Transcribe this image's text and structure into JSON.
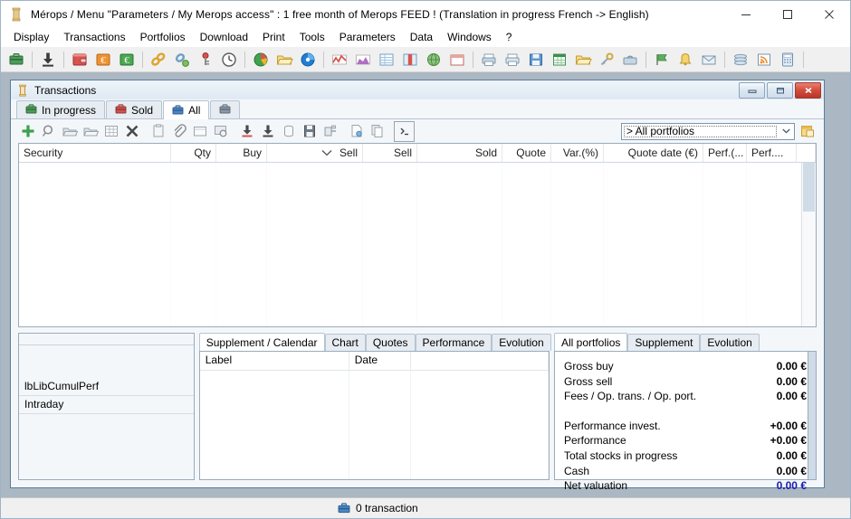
{
  "window": {
    "title": "Mérops / Menu \"Parameters / My Merops access\" : 1 free month of Merops FEED ! (Translation in progress French -> English)",
    "app_icon": "merops-column-icon",
    "controls": {
      "minimize": "minimize-icon",
      "maximize": "maximize-icon",
      "close": "close-icon"
    }
  },
  "menubar": {
    "items": [
      {
        "label": "Display"
      },
      {
        "label": "Transactions"
      },
      {
        "label": "Portfolios"
      },
      {
        "label": "Download"
      },
      {
        "label": "Print"
      },
      {
        "label": "Tools"
      },
      {
        "label": "Parameters"
      },
      {
        "label": "Data"
      },
      {
        "label": "Windows"
      },
      {
        "label": "?"
      }
    ]
  },
  "toolbar": {
    "groups": [
      [
        "briefcase-green-icon"
      ],
      [
        "download-arrow-icon"
      ],
      [
        "wallet-red-icon",
        "euro-orange-icon",
        "euro-green-icon"
      ],
      [
        "link-chain-icon",
        "link-settings-icon",
        "key-red-icon",
        "clock-icon"
      ],
      [
        "pie-chart-icon",
        "folder-yellow-icon",
        "blue-circle-icon"
      ],
      [
        "chart-line-red-icon",
        "chart-area-purple-icon",
        "table-blue-icon",
        "book-red-icon",
        "globe-green-icon",
        "window-red-icon"
      ],
      [
        "print-icon",
        "printer-icon",
        "save-blue-icon",
        "spreadsheet-green-icon",
        "folder-open-icon",
        "key-tools-icon",
        "toolbox-icon"
      ],
      [
        "flag-green-icon",
        "bell-yellow-icon",
        "mail-icon"
      ],
      [
        "layers-icon",
        "rss-orange-icon",
        "calculator-blue-icon"
      ]
    ]
  },
  "mdi": {
    "title": "Transactions",
    "title_icon": "merops-column-icon",
    "buttons": {
      "minimize": "mdi-minimize-icon",
      "restore": "mdi-restore-icon",
      "close": "mdi-close-icon"
    },
    "tabs": [
      {
        "label": "In progress",
        "icon": "briefcase-green-icon",
        "active": false
      },
      {
        "label": "Sold",
        "icon": "briefcase-red-icon",
        "active": false
      },
      {
        "label": "All",
        "icon": "briefcase-blue-icon",
        "active": true
      },
      {
        "label": "",
        "icon": "briefcase-grey-icon",
        "active": false
      }
    ],
    "row_toolbar": [
      "add-plus-icon",
      "search-magnifier-icon",
      "archive-in-icon",
      "archive-out-icon",
      "grid-table-icon",
      "delete-x-icon",
      "clipboard-icon",
      "attachment-clip-icon",
      "note-icon",
      "note-search-icon",
      "import-down-red-icon",
      "export-down-icon",
      "database-icon",
      "save-doc-icon",
      "printer-small-icon",
      "new-doc-icon",
      "copy-doc-icon",
      "console-icon"
    ],
    "portfolio_select": {
      "value": "> All portfolios",
      "arrow_icon": "chevron-down-icon",
      "extra_icon": "portfolio-edit-icon"
    }
  },
  "grid": {
    "columns": [
      {
        "label": "Security",
        "align": "left",
        "width": 168
      },
      {
        "label": "Qty",
        "align": "right",
        "width": 50
      },
      {
        "label": "Buy",
        "align": "right",
        "width": 56
      },
      {
        "label": "Sell",
        "align": "right",
        "width": 106,
        "sort_icon": "sort-desc-icon"
      },
      {
        "label": "Sell",
        "align": "right",
        "width": 60
      },
      {
        "label": "Sold",
        "align": "right",
        "width": 94
      },
      {
        "label": "Quote",
        "align": "right",
        "width": 54
      },
      {
        "label": "Var.(%)",
        "align": "right",
        "width": 58
      },
      {
        "label": "Quote date (€)",
        "align": "right",
        "width": 110
      },
      {
        "label": "Perf.(...",
        "align": "left",
        "width": 48
      },
      {
        "label": "Perf....",
        "align": "left",
        "width": 55
      }
    ],
    "rows": []
  },
  "left_panel": {
    "rows": [
      {
        "label": "lbLibCumulPerf"
      },
      {
        "label": "Intraday"
      }
    ]
  },
  "mid_panel": {
    "tabs": [
      {
        "label": "Supplement / Calendar",
        "active": true
      },
      {
        "label": "Chart",
        "active": false
      },
      {
        "label": "Quotes",
        "active": false
      },
      {
        "label": "Performance",
        "active": false
      },
      {
        "label": "Evolution",
        "active": false
      }
    ],
    "spinner": {
      "prev": "left-arrow-icon",
      "next": "right-arrow-icon"
    },
    "columns": [
      {
        "label": "Label",
        "width": 165
      },
      {
        "label": "Date",
        "width": 68
      },
      {
        "label": "",
        "width": 150
      }
    ],
    "rows": []
  },
  "right_panel": {
    "tabs": [
      {
        "label": "All portfolios",
        "active": true
      },
      {
        "label": "Supplement",
        "active": false
      },
      {
        "label": "Evolution",
        "active": false
      }
    ],
    "summary_top": [
      {
        "label": "Gross buy",
        "value": "0.00 €"
      },
      {
        "label": "Gross sell",
        "value": "0.00 €"
      },
      {
        "label": "Fees / Op. trans. / Op. port.",
        "value": "0.00 €"
      }
    ],
    "summary_bottom": [
      {
        "label": "Performance invest.",
        "value": "+0.00 €",
        "color": "#000000"
      },
      {
        "label": "Performance",
        "value": "+0.00 €",
        "color": "#000000"
      },
      {
        "label": "Total stocks in progress",
        "value": "0.00 €",
        "color": "#000000"
      },
      {
        "label": "Cash",
        "value": "0.00 €",
        "color": "#000000"
      },
      {
        "label": "Net valuation",
        "value": "0.00 €",
        "color": "#1a1ab0"
      }
    ]
  },
  "statusbar": {
    "icon": "briefcase-blue-icon",
    "text": "0 transaction"
  },
  "colors": {
    "accent_blue": "#1a1ab0",
    "mdi_background": "#abb7c2",
    "window_border": "#5a7d9a"
  }
}
